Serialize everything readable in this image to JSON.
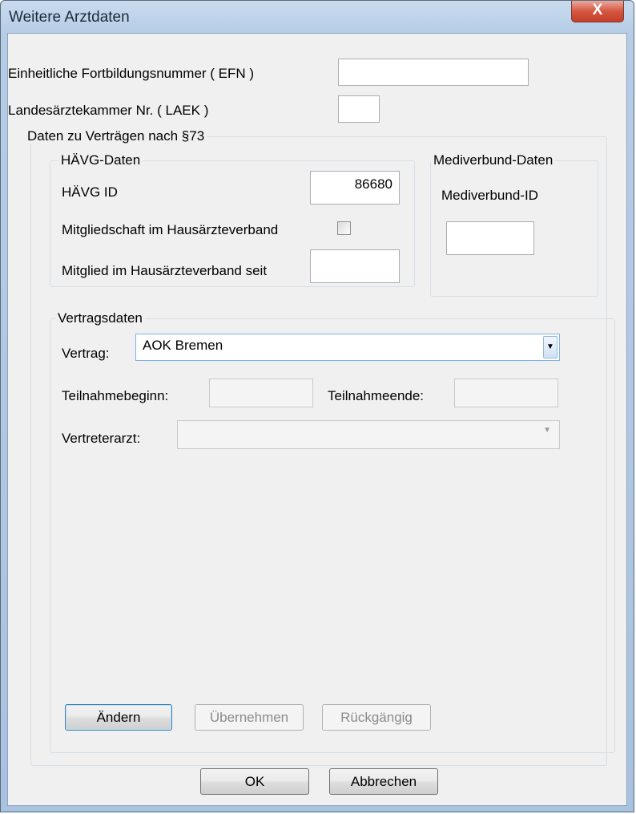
{
  "window": {
    "title": "Weitere Arztdaten",
    "close_label": "X"
  },
  "top": {
    "efn_label": "Einheitliche Fortbildungsnummer ( EFN )",
    "efn_value": "",
    "laek_label": "Landesärztekammer Nr. ( LAEK )",
    "laek_value": ""
  },
  "section73": {
    "legend": "Daten zu Verträgen nach §73",
    "haevg": {
      "legend": "HÄVG-Daten",
      "id_label": "HÄVG ID",
      "id_value": "86680",
      "member_label": "Mitgliedschaft im Hausärzteverband",
      "member_checked": false,
      "since_label": "Mitglied im Hausärzteverband seit",
      "since_value": ""
    },
    "mediverbund": {
      "legend": "Mediverbund-Daten",
      "id_label": "Mediverbund-ID",
      "id_value": ""
    },
    "vertragsdaten": {
      "legend": "Vertragsdaten",
      "vertrag_label": "Vertrag:",
      "vertrag_value": "AOK Bremen",
      "start_label": "Teilnahmebeginn:",
      "start_value": "",
      "end_label": "Teilnahmeende:",
      "end_value": "",
      "vertreter_label": "Vertreterarzt:",
      "vertreter_value": ""
    },
    "buttons": {
      "aendern": "Ändern",
      "uebernehmen": "Übernehmen",
      "rueckgaengig": "Rückgängig"
    }
  },
  "footer": {
    "ok": "OK",
    "cancel": "Abbrechen"
  },
  "colors": {
    "titlebar": "#b6cde6",
    "client_bg": "#f0f0f0",
    "close_button": "#c43e2a",
    "combo_focus_border": "#7eb4ea"
  }
}
